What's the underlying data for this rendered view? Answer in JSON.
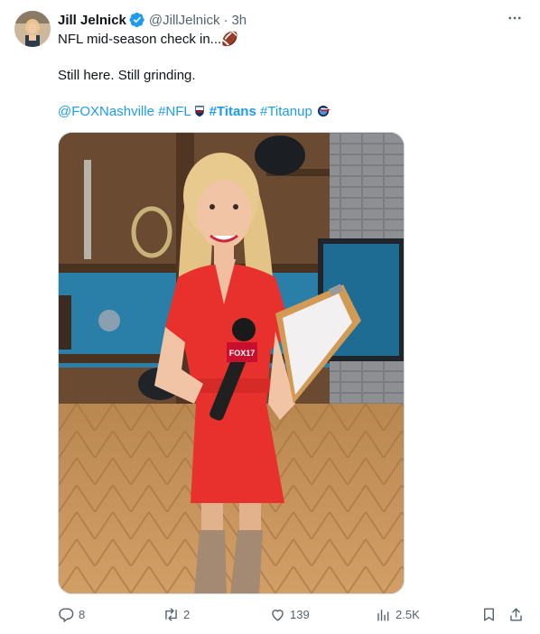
{
  "tweet": {
    "author_name": "Jill Jelnick",
    "handle": "@JillJelnick",
    "separator": "·",
    "time": "3h",
    "line1": "NFL mid-season check in...",
    "line1_emoji": "🏈",
    "line2": "Still here. Still grinding.",
    "mentions": {
      "account": "@FOXNashville",
      "tag_nfl": "#NFL",
      "tag_titans": "#Titans",
      "tag_titanup": "#Titanup"
    },
    "media": {
      "mic_flag_text": "FOX17"
    }
  },
  "actions": {
    "replies": "8",
    "reposts": "2",
    "likes": "139",
    "views": "2.5K"
  },
  "colors": {
    "link": "#1d9bf0",
    "secondary_text": "#536471",
    "verified": "#1d9bf0",
    "dress": "#e8312c"
  },
  "icons": [
    "verified-badge-icon",
    "more-icon",
    "nfl-shield-icon",
    "titans-logo-icon",
    "reply-icon",
    "repost-icon",
    "like-icon",
    "views-icon",
    "bookmark-icon",
    "share-icon"
  ]
}
